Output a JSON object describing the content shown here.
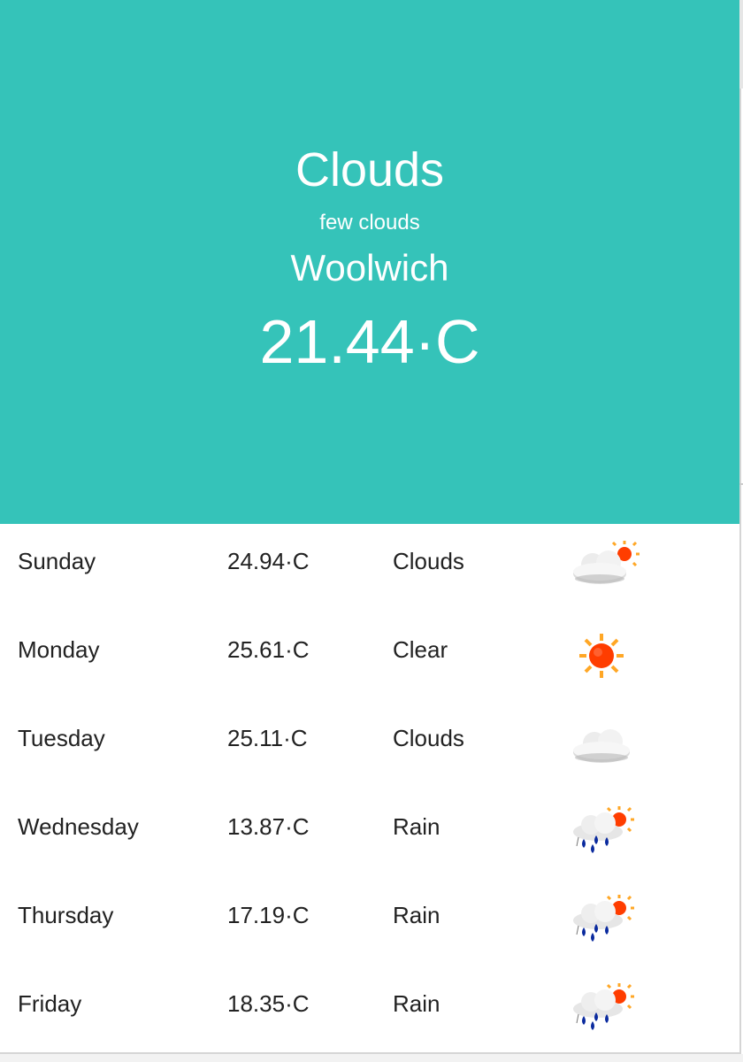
{
  "current": {
    "main": "Clouds",
    "description": "few clouds",
    "city": "Woolwich",
    "temperature": "21.44·C"
  },
  "forecast": [
    {
      "day": "Sunday",
      "temp": "24.94·C",
      "condition": "Clouds",
      "icon": "cloud-sun-icon"
    },
    {
      "day": "Monday",
      "temp": "25.61·C",
      "condition": "Clear",
      "icon": "sun-icon"
    },
    {
      "day": "Tuesday",
      "temp": "25.11·C",
      "condition": "Clouds",
      "icon": "cloud-icon"
    },
    {
      "day": "Wednesday",
      "temp": "13.87·C",
      "condition": "Rain",
      "icon": "rain-sun-icon"
    },
    {
      "day": "Thursday",
      "temp": "17.19·C",
      "condition": "Rain",
      "icon": "rain-sun-icon"
    },
    {
      "day": "Friday",
      "temp": "18.35·C",
      "condition": "Rain",
      "icon": "rain-sun-icon"
    }
  ],
  "colors": {
    "hero_background": "#35c3b9",
    "hero_text": "#ffffff",
    "row_text": "#222222",
    "sun": "#ff3d00",
    "sun_rays": "#ffa726",
    "rain_drop": "#0a2a9e"
  }
}
